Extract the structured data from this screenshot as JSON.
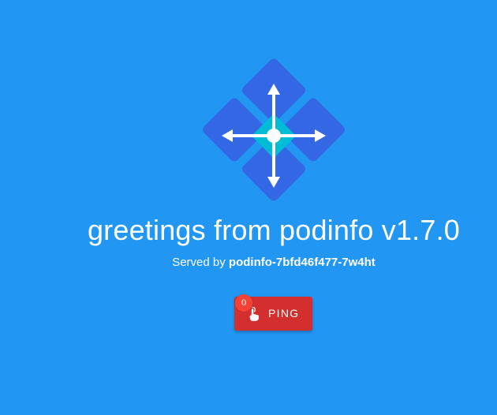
{
  "title": "greetings from podinfo v1.7.0",
  "served": {
    "prefix": "Served by",
    "host": "podinfo-7bfd46f477-7w4ht"
  },
  "ping": {
    "label": "PING",
    "count": "0"
  },
  "icons": {
    "logo": "podinfo-logo-icon",
    "ping": "touch-hand-icon"
  },
  "colors": {
    "background": "#2196f3",
    "logo_diamond": "#3367e3",
    "logo_center": "#00bcd4",
    "button": "#d32f2f",
    "badge": "#f44336"
  }
}
